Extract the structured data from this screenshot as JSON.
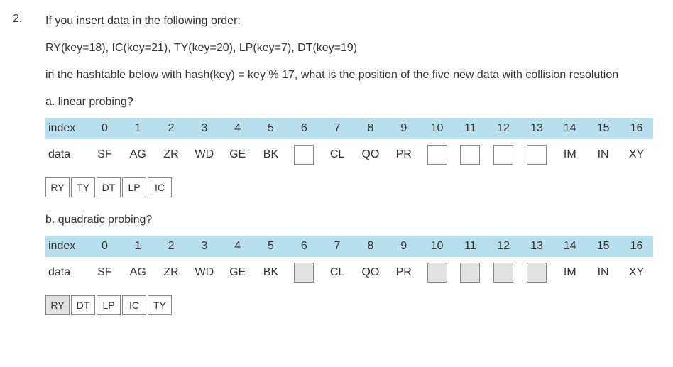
{
  "question_number": "2.",
  "prompt_line1": "If you insert data in the following order:",
  "prompt_line2": "RY(key=18), IC(key=21), TY(key=20), LP(key=7), DT(key=19)",
  "prompt_line3": "in the hashtable below with hash(key) = key % 17, what is the position of the five new data with collision resolution",
  "part_a": {
    "label": "a. linear probing?",
    "index_label": "index",
    "data_label": "data",
    "indices": [
      "0",
      "1",
      "2",
      "3",
      "4",
      "5",
      "6",
      "7",
      "8",
      "9",
      "10",
      "11",
      "12",
      "13",
      "14",
      "15",
      "16"
    ],
    "cells": [
      {
        "t": "SF"
      },
      {
        "t": "AG"
      },
      {
        "t": "ZR"
      },
      {
        "t": "WD"
      },
      {
        "t": "GE"
      },
      {
        "t": "BK"
      },
      {
        "slot": true,
        "shaded": false
      },
      {
        "t": "CL"
      },
      {
        "t": "QO"
      },
      {
        "t": "PR"
      },
      {
        "slot": true,
        "shaded": false
      },
      {
        "slot": true,
        "shaded": false
      },
      {
        "slot": true,
        "shaded": false
      },
      {
        "slot": true,
        "shaded": false
      },
      {
        "t": "IM"
      },
      {
        "t": "IN"
      },
      {
        "t": "XY"
      }
    ],
    "chips": [
      "RY",
      "TY",
      "DT",
      "LP",
      "IC"
    ]
  },
  "part_b": {
    "label": "b. quadratic probing?",
    "index_label": "index",
    "data_label": "data",
    "indices": [
      "0",
      "1",
      "2",
      "3",
      "4",
      "5",
      "6",
      "7",
      "8",
      "9",
      "10",
      "11",
      "12",
      "13",
      "14",
      "15",
      "16"
    ],
    "cells": [
      {
        "t": "SF"
      },
      {
        "t": "AG"
      },
      {
        "t": "ZR"
      },
      {
        "t": "WD"
      },
      {
        "t": "GE"
      },
      {
        "t": "BK"
      },
      {
        "slot": true,
        "shaded": true
      },
      {
        "t": "CL"
      },
      {
        "t": "QO"
      },
      {
        "t": "PR"
      },
      {
        "slot": true,
        "shaded": true
      },
      {
        "slot": true,
        "shaded": true
      },
      {
        "slot": true,
        "shaded": true
      },
      {
        "slot": true,
        "shaded": true
      },
      {
        "t": "IM"
      },
      {
        "t": "IN"
      },
      {
        "t": "XY"
      }
    ],
    "chips": [
      "RY",
      "DT",
      "LP",
      "IC",
      "TY"
    ]
  }
}
